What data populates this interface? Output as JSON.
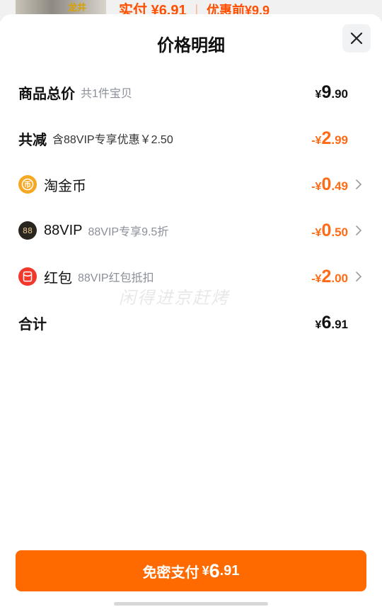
{
  "backdrop": {
    "thumb_text": "龙井",
    "paid_label": "实付",
    "paid_currency": "¥",
    "paid_amount": "6.91",
    "before_label": "优惠前",
    "before_currency": "¥",
    "before_amount": "9.9"
  },
  "sheet": {
    "title": "价格明细"
  },
  "rows": [
    {
      "label": "商品总价",
      "note": "共1件宝贝",
      "currency": "¥",
      "int": "9",
      "dec": ".90",
      "color": "#111111",
      "chevron": false
    },
    {
      "label": "共减",
      "note": "含88VIP专享优惠￥2.50",
      "currency": "-¥",
      "int": "2",
      "dec": ".99",
      "color": "#ff6a14",
      "chevron": false
    },
    {
      "label": "淘金币",
      "note": "",
      "currency": "-¥",
      "int": "0",
      "dec": ".49",
      "color": "#ff6a14",
      "chevron": true,
      "icon": "coin-icon"
    },
    {
      "label": "88VIP",
      "note": "88VIP专享9.5折",
      "currency": "-¥",
      "int": "0",
      "dec": ".50",
      "color": "#ff6a14",
      "chevron": true,
      "icon": "vip88-icon"
    },
    {
      "label": "红包",
      "note": "88VIP红包抵扣",
      "currency": "-¥",
      "int": "2",
      "dec": ".00",
      "color": "#ff6a14",
      "chevron": true,
      "icon": "red-packet-icon"
    },
    {
      "label": "合计",
      "note": "",
      "currency": "¥",
      "int": "6",
      "dec": ".91",
      "color": "#111111",
      "chevron": false
    }
  ],
  "watermark": "闲得进京赶烤",
  "pay_button": {
    "label": "免密支付",
    "currency": "¥",
    "int": "6",
    "dec": ".91"
  },
  "colors": {
    "accent": "#ff6a00",
    "discount": "#ff6a14",
    "note_gray": "#8a8f99"
  }
}
